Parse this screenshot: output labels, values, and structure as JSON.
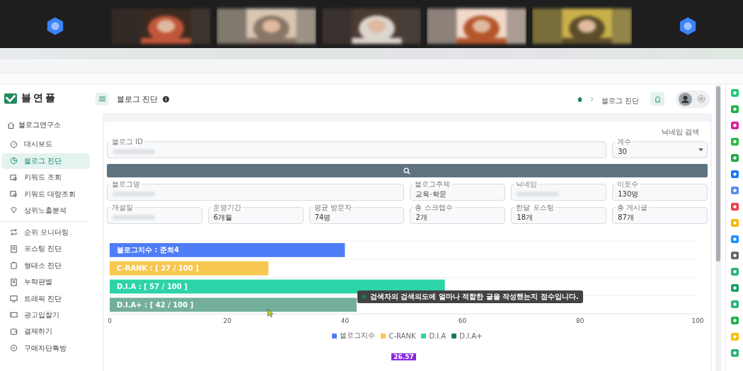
{
  "video_strip": {
    "tiles": [
      {
        "kind": "avatar"
      },
      {
        "kind": "picture"
      },
      {
        "kind": "picture"
      },
      {
        "kind": "picture"
      },
      {
        "kind": "picture"
      },
      {
        "kind": "picture"
      },
      {
        "kind": "avatar"
      }
    ]
  },
  "app": {
    "logo": "블연플",
    "page_title": "블로그 진단",
    "breadcrumb": [
      "블로그 진단"
    ]
  },
  "sidebar": {
    "header": "블로그연구소",
    "groups": [
      [
        {
          "label": "대시보드",
          "selected": false
        },
        {
          "label": "블로그 진단",
          "selected": true
        },
        {
          "label": "키워드 조회",
          "selected": false
        },
        {
          "label": "키워드 대량조회",
          "selected": false
        },
        {
          "label": "상위노출분석",
          "selected": false
        }
      ],
      [
        {
          "label": "순위 모니터링",
          "selected": false
        },
        {
          "label": "포스팅 진단",
          "selected": false
        },
        {
          "label": "형태소 진단",
          "selected": false
        },
        {
          "label": "누락판별",
          "selected": false
        },
        {
          "label": "트래픽 진단",
          "selected": false
        },
        {
          "label": "광고입찰기",
          "selected": false
        },
        {
          "label": "결제하기",
          "selected": false
        },
        {
          "label": "구매자단톡방",
          "selected": false
        }
      ]
    ]
  },
  "form": {
    "nickname_search": "닉네임 검색",
    "fields": [
      {
        "label": "블로그 ID",
        "redacted": true
      },
      {
        "label": "계수",
        "value": "30",
        "kind": "select"
      },
      {
        "label": "블로그명",
        "redacted": true
      },
      {
        "label": "블로그주제",
        "value": "교육·학문"
      },
      {
        "label": "닉네임",
        "redacted": true
      },
      {
        "label": "이웃수",
        "value": "130명"
      },
      {
        "label": "개설일",
        "redacted": true
      },
      {
        "label": "운영기간",
        "value": "6개월"
      },
      {
        "label": "평균 방문자",
        "value": "74명"
      },
      {
        "label": "총 스크랩수",
        "value": "2개"
      },
      {
        "label": "한달 포스팅",
        "value": "18개"
      },
      {
        "label": "총 게시글",
        "value": "87개"
      }
    ]
  },
  "chart_data": {
    "type": "bar",
    "orientation": "horizontal",
    "stacked": true,
    "legend": "bottom",
    "categories": [
      "블로그지수 : 준최4",
      "C-RANK : [ 27 / 100 ]",
      "D.I.A : [ 57 / 100 ]",
      "D.I.A+ : [ 42 / 100 ]"
    ],
    "series": [
      {
        "name": "블로그지수",
        "color": "#4f7cf7",
        "values": [
          40,
          null,
          null,
          null
        ]
      },
      {
        "name": "C-RANK",
        "color": "#f8c74f",
        "values": [
          null,
          27,
          null,
          null
        ]
      },
      {
        "name": "D.I.A",
        "color": "#2dd4a8",
        "values": [
          null,
          null,
          57,
          null
        ]
      },
      {
        "name": "D.I.A+",
        "color": "#157a56",
        "values": [
          null,
          null,
          null,
          42
        ]
      }
    ],
    "xlim": [
      0,
      100
    ],
    "xticks": [
      0,
      20,
      40,
      60,
      80,
      100
    ],
    "annotations": [
      "검색자의 검색의도에 얼마나 적합한 글을 작성했는지 점수입니다."
    ]
  },
  "badge": "26.57"
}
